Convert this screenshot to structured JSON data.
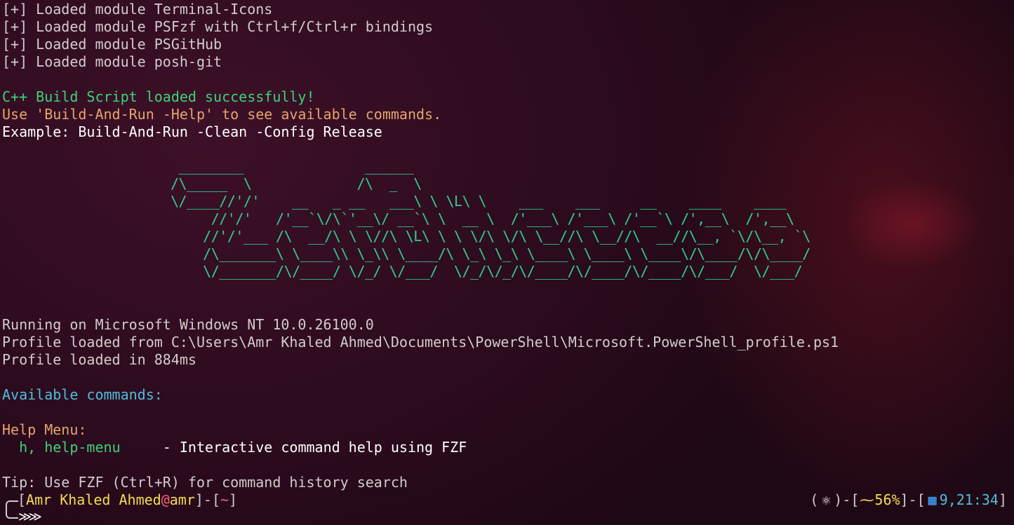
{
  "modules": [
    "[+] Loaded module Terminal-Icons",
    "[+] Loaded module PSFzf with Ctrl+f/Ctrl+r bindings",
    "[+] Loaded module PSGitHub",
    "[+] Loaded module posh-git"
  ],
  "build": {
    "success": "C++ Build Script loaded successfully!",
    "help": "Use 'Build-And-Run -Help' to see available commands.",
    "example": "Example: Build-And-Run -Clean -Config Release"
  },
  "ascii_banner": " ________               ______\n/\\_____  \\             /\\  _  \\\n\\/____//'/'    __   _ __   ___\\ \\ \\L\\ \\    ___    ___     __    ____    ____\n     //'/'   /'__`\\/\\`'__\\/ __`\\ \\  __ \\  /'___\\ /'___\\ /'__`\\ /',__\\  /',__\\\n    //'/'___ /\\  __/\\ \\ \\//\\ \\L\\ \\ \\ \\/\\ \\/\\ \\__//\\ \\__//\\  __//\\__, `\\/\\__, `\\\n    /\\_______\\ \\____\\\\ \\_\\\\ \\____/\\ \\_\\ \\_\\ \\____\\ \\____\\ \\____\\/\\____/\\/\\____/\n    \\/_______/\\/____/ \\/_/ \\/___/  \\/_/\\/_/\\/____/\\/____/\\/____/\\/___/  \\/___/",
  "system": {
    "os": "Running on Microsoft Windows NT 10.0.26100.0",
    "profile_path": "Profile loaded from C:\\Users\\Amr Khaled Ahmed\\Documents\\PowerShell\\Microsoft.PowerShell_profile.ps1",
    "load_time": "Profile loaded in 884ms"
  },
  "commands": {
    "header": "Available commands:",
    "help_menu_title": "Help Menu:",
    "help_cmd": "  h, help-menu",
    "help_desc": "     - Interactive command help using FZF"
  },
  "tip": "Tip: Use FZF (Ctrl+R) for command history search",
  "prompt": {
    "open": "[",
    "user": "Amr Khaled Ahmed",
    "at": "@",
    "host": "amr",
    "mid": "]-[",
    "path": "~",
    "close": "]",
    "arrows": "≫",
    "right_open": "(",
    "atom_glyph": "⚛",
    "right_sep1": ")-[",
    "pulse_glyph": "⁓",
    "battery": "56%",
    "right_sep2": "]-[",
    "cal_glyph": "▦",
    "time": "9,21:34",
    "right_close": "]"
  },
  "colors": {
    "success_green": "#3cd27a",
    "warning_orange": "#e5a56c",
    "info_cyan": "#4dbfd9",
    "banner_green": "#2fd08e",
    "prompt_yellow": "#f5dd52",
    "prompt_pink": "#ff5c7a"
  }
}
